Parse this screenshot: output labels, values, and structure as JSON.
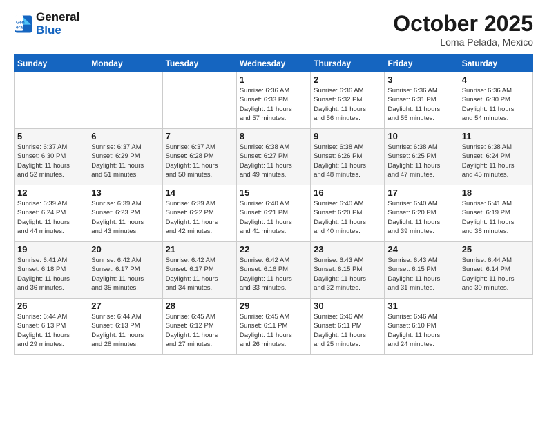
{
  "header": {
    "logo_line1": "General",
    "logo_line2": "Blue",
    "month": "October 2025",
    "location": "Loma Pelada, Mexico"
  },
  "weekdays": [
    "Sunday",
    "Monday",
    "Tuesday",
    "Wednesday",
    "Thursday",
    "Friday",
    "Saturday"
  ],
  "weeks": [
    [
      {
        "day": "",
        "info": ""
      },
      {
        "day": "",
        "info": ""
      },
      {
        "day": "",
        "info": ""
      },
      {
        "day": "1",
        "info": "Sunrise: 6:36 AM\nSunset: 6:33 PM\nDaylight: 11 hours\nand 57 minutes."
      },
      {
        "day": "2",
        "info": "Sunrise: 6:36 AM\nSunset: 6:32 PM\nDaylight: 11 hours\nand 56 minutes."
      },
      {
        "day": "3",
        "info": "Sunrise: 6:36 AM\nSunset: 6:31 PM\nDaylight: 11 hours\nand 55 minutes."
      },
      {
        "day": "4",
        "info": "Sunrise: 6:36 AM\nSunset: 6:30 PM\nDaylight: 11 hours\nand 54 minutes."
      }
    ],
    [
      {
        "day": "5",
        "info": "Sunrise: 6:37 AM\nSunset: 6:30 PM\nDaylight: 11 hours\nand 52 minutes."
      },
      {
        "day": "6",
        "info": "Sunrise: 6:37 AM\nSunset: 6:29 PM\nDaylight: 11 hours\nand 51 minutes."
      },
      {
        "day": "7",
        "info": "Sunrise: 6:37 AM\nSunset: 6:28 PM\nDaylight: 11 hours\nand 50 minutes."
      },
      {
        "day": "8",
        "info": "Sunrise: 6:38 AM\nSunset: 6:27 PM\nDaylight: 11 hours\nand 49 minutes."
      },
      {
        "day": "9",
        "info": "Sunrise: 6:38 AM\nSunset: 6:26 PM\nDaylight: 11 hours\nand 48 minutes."
      },
      {
        "day": "10",
        "info": "Sunrise: 6:38 AM\nSunset: 6:25 PM\nDaylight: 11 hours\nand 47 minutes."
      },
      {
        "day": "11",
        "info": "Sunrise: 6:38 AM\nSunset: 6:24 PM\nDaylight: 11 hours\nand 45 minutes."
      }
    ],
    [
      {
        "day": "12",
        "info": "Sunrise: 6:39 AM\nSunset: 6:24 PM\nDaylight: 11 hours\nand 44 minutes."
      },
      {
        "day": "13",
        "info": "Sunrise: 6:39 AM\nSunset: 6:23 PM\nDaylight: 11 hours\nand 43 minutes."
      },
      {
        "day": "14",
        "info": "Sunrise: 6:39 AM\nSunset: 6:22 PM\nDaylight: 11 hours\nand 42 minutes."
      },
      {
        "day": "15",
        "info": "Sunrise: 6:40 AM\nSunset: 6:21 PM\nDaylight: 11 hours\nand 41 minutes."
      },
      {
        "day": "16",
        "info": "Sunrise: 6:40 AM\nSunset: 6:20 PM\nDaylight: 11 hours\nand 40 minutes."
      },
      {
        "day": "17",
        "info": "Sunrise: 6:40 AM\nSunset: 6:20 PM\nDaylight: 11 hours\nand 39 minutes."
      },
      {
        "day": "18",
        "info": "Sunrise: 6:41 AM\nSunset: 6:19 PM\nDaylight: 11 hours\nand 38 minutes."
      }
    ],
    [
      {
        "day": "19",
        "info": "Sunrise: 6:41 AM\nSunset: 6:18 PM\nDaylight: 11 hours\nand 36 minutes."
      },
      {
        "day": "20",
        "info": "Sunrise: 6:42 AM\nSunset: 6:17 PM\nDaylight: 11 hours\nand 35 minutes."
      },
      {
        "day": "21",
        "info": "Sunrise: 6:42 AM\nSunset: 6:17 PM\nDaylight: 11 hours\nand 34 minutes."
      },
      {
        "day": "22",
        "info": "Sunrise: 6:42 AM\nSunset: 6:16 PM\nDaylight: 11 hours\nand 33 minutes."
      },
      {
        "day": "23",
        "info": "Sunrise: 6:43 AM\nSunset: 6:15 PM\nDaylight: 11 hours\nand 32 minutes."
      },
      {
        "day": "24",
        "info": "Sunrise: 6:43 AM\nSunset: 6:15 PM\nDaylight: 11 hours\nand 31 minutes."
      },
      {
        "day": "25",
        "info": "Sunrise: 6:44 AM\nSunset: 6:14 PM\nDaylight: 11 hours\nand 30 minutes."
      }
    ],
    [
      {
        "day": "26",
        "info": "Sunrise: 6:44 AM\nSunset: 6:13 PM\nDaylight: 11 hours\nand 29 minutes."
      },
      {
        "day": "27",
        "info": "Sunrise: 6:44 AM\nSunset: 6:13 PM\nDaylight: 11 hours\nand 28 minutes."
      },
      {
        "day": "28",
        "info": "Sunrise: 6:45 AM\nSunset: 6:12 PM\nDaylight: 11 hours\nand 27 minutes."
      },
      {
        "day": "29",
        "info": "Sunrise: 6:45 AM\nSunset: 6:11 PM\nDaylight: 11 hours\nand 26 minutes."
      },
      {
        "day": "30",
        "info": "Sunrise: 6:46 AM\nSunset: 6:11 PM\nDaylight: 11 hours\nand 25 minutes."
      },
      {
        "day": "31",
        "info": "Sunrise: 6:46 AM\nSunset: 6:10 PM\nDaylight: 11 hours\nand 24 minutes."
      },
      {
        "day": "",
        "info": ""
      }
    ]
  ]
}
